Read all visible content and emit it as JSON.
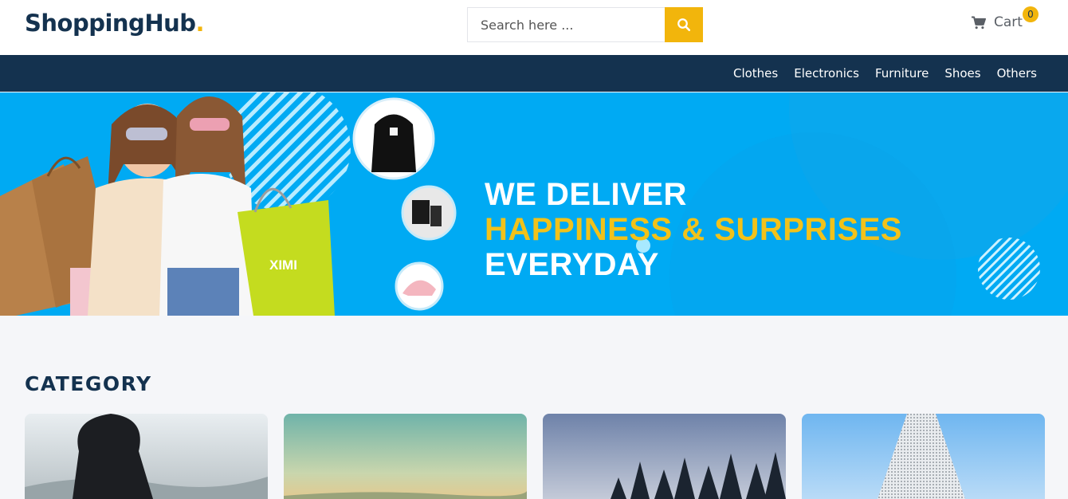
{
  "header": {
    "logo_main": "ShoppingHub",
    "logo_dot": ".",
    "search_placeholder": "Search here ...",
    "cart_label": "Cart",
    "cart_count": "0"
  },
  "nav": {
    "items": [
      "Clothes",
      "Electronics",
      "Furniture",
      "Shoes",
      "Others"
    ]
  },
  "banner": {
    "line1": "WE DELIVER",
    "line2_highlight": "HAPPINESS & SURPRISES",
    "line2_rest": "EVERYDAY",
    "product_bubbles": [
      "backpack",
      "perfume",
      "cap"
    ]
  },
  "category": {
    "title": "CATEGORY",
    "cards": [
      "person-on-hill-image",
      "meadow-sky-image",
      "pine-forest-image",
      "skyscraper-image"
    ]
  },
  "colors": {
    "brand_navy": "#14324f",
    "accent_yellow": "#f2b50c",
    "banner_blue": "#00aaf3"
  }
}
